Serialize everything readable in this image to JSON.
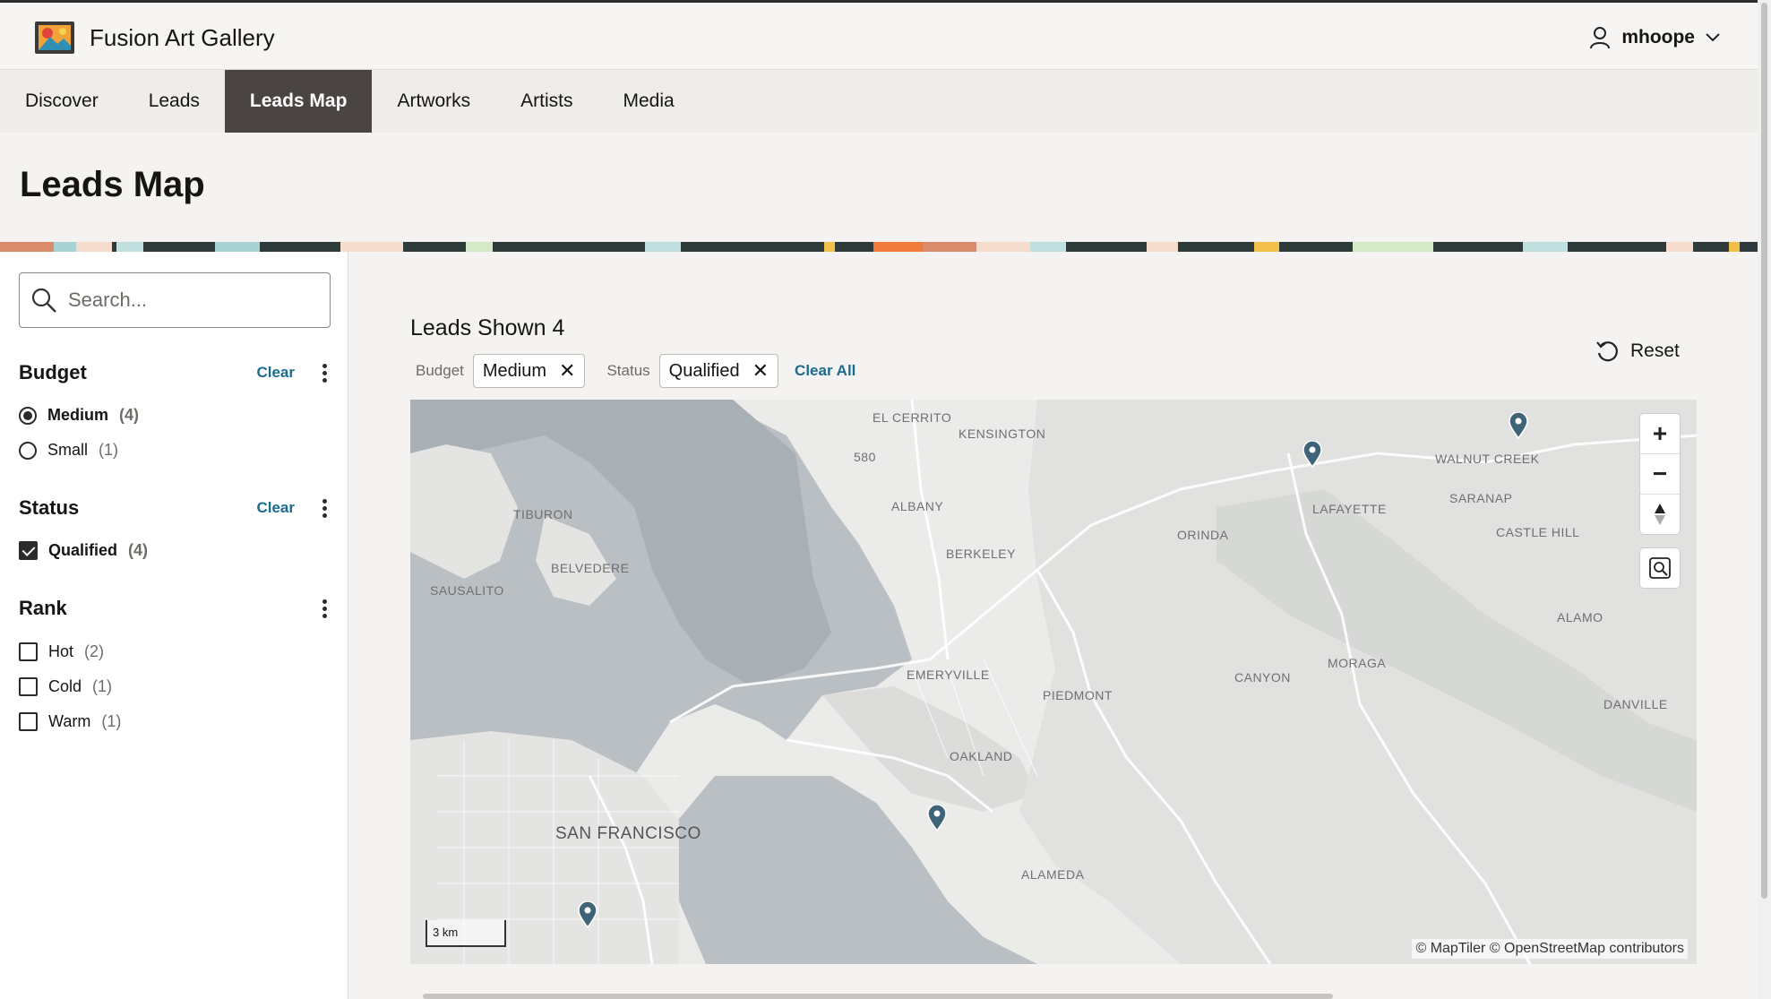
{
  "app": {
    "title": "Fusion Art Gallery",
    "user": "mhoope"
  },
  "nav": {
    "tabs": [
      {
        "label": "Discover"
      },
      {
        "label": "Leads"
      },
      {
        "label": "Leads Map"
      },
      {
        "label": "Artworks"
      },
      {
        "label": "Artists"
      },
      {
        "label": "Media"
      }
    ],
    "active": "Leads Map"
  },
  "page": {
    "title": "Leads Map"
  },
  "search": {
    "placeholder": "Search..."
  },
  "facets": {
    "budget": {
      "title": "Budget",
      "clear": "Clear",
      "options": [
        {
          "label": "Medium",
          "count": "(4)",
          "selected": true
        },
        {
          "label": "Small",
          "count": "(1)",
          "selected": false
        }
      ]
    },
    "status": {
      "title": "Status",
      "clear": "Clear",
      "options": [
        {
          "label": "Qualified",
          "count": "(4)",
          "selected": true
        }
      ]
    },
    "rank": {
      "title": "Rank",
      "options": [
        {
          "label": "Hot",
          "count": "(2)",
          "selected": false
        },
        {
          "label": "Cold",
          "count": "(1)",
          "selected": false
        },
        {
          "label": "Warm",
          "count": "(1)",
          "selected": false
        }
      ]
    }
  },
  "results": {
    "count_text": "Leads Shown 4",
    "filters": [
      {
        "label": "Budget",
        "value": "Medium"
      },
      {
        "label": "Status",
        "value": "Qualified"
      }
    ],
    "clear_all": "Clear All",
    "reset": "Reset"
  },
  "map": {
    "labels": {
      "el_cerrito": "EL CERRITO",
      "kensington": "KENSINGTON",
      "walnut_creek": "WALNUT CREEK",
      "tiburon": "TIBURON",
      "albany": "ALBANY",
      "lafayette": "LAFAYETTE",
      "saranap": "SARANAP",
      "orinda": "ORINDA",
      "castle_hill": "CASTLE HILL",
      "berkeley": "BERKELEY",
      "belvedere": "BELVEDERE",
      "sausalito": "SAUSALITO",
      "alamo": "ALAMO",
      "moraga": "MORAGA",
      "emeryville": "EMERYVILLE",
      "canyon": "CANYON",
      "piedmont": "PIEDMONT",
      "danville": "DANVILLE",
      "oakland": "OAKLAND",
      "san_francisco": "SAN FRANCISCO",
      "alameda": "ALAMEDA",
      "road_580": "580",
      "road_580b": "580"
    },
    "scale": "3 km",
    "attribution": "© MapTiler  © OpenStreetMap contributors",
    "marker_color": "#3f6478"
  }
}
